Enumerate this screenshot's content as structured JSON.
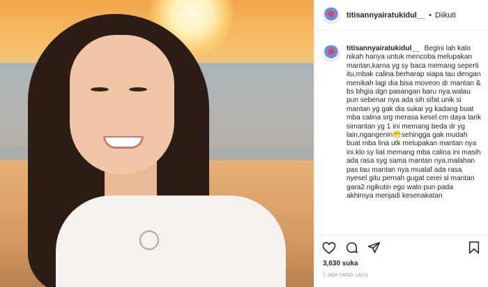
{
  "post": {
    "username": "titisannyairatukidul__",
    "follow_status": "Diikuti",
    "caption": "Begini lah kalo nikah hanya untuk mencoba melupakan mantan,karna yg sy baca memang seperti itu,mbak calina berharap siapa tau dengan menikah lagi dia bisa moveon dr mantan & bs bhgia dgn pasangan baru nya.walau pun sebenar nya ada sih sifat unik si mantan yg gak dia sukai yg kadang buat mba calina srg merasa kesel.cm daya tarik simantan yg 1 ini memang beda dr yg lain,ngangenin😁sehingga gak mudah buat mba lina utk melupakan mantan nya ini.klo sy liat memang mba calina ini masih ada rasa syg sama mantan nya.malahan pas tau mantan nya mualaf ada rasa nyesel gitu pernah gugat cerei si mantan gara2 ngikutin ego walo pun pada akhirnya menjadi kesenakatan",
    "likes": "3,630 suka",
    "timestamp": "7 JAM YANG LALU"
  },
  "icons": {
    "like": "heart-icon",
    "comment": "comment-icon",
    "share": "share-icon",
    "save": "bookmark-icon"
  }
}
